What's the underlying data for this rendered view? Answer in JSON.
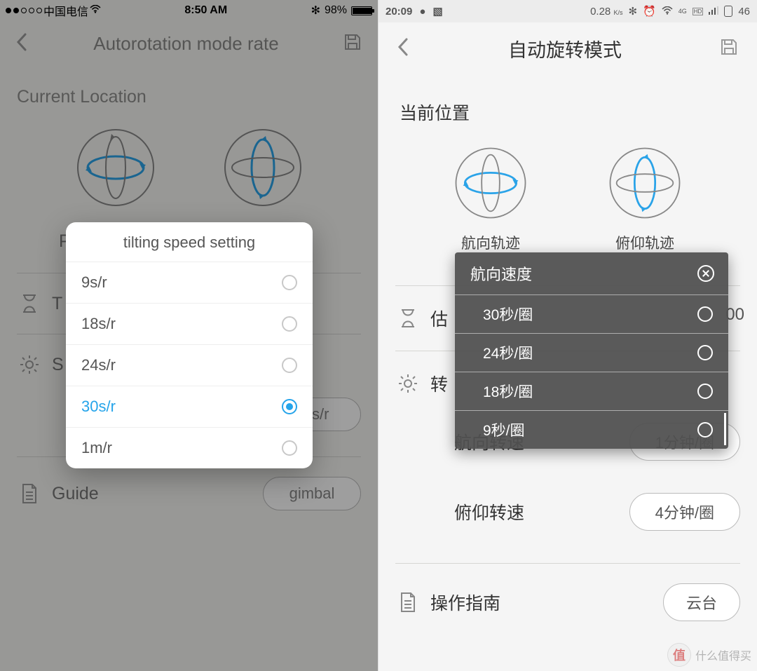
{
  "left": {
    "status": {
      "carrier": "中国电信",
      "time": "8:50 AM",
      "bt": "✻",
      "battery_pct": "98%"
    },
    "navbar": {
      "title": "Autorotation mode rate"
    },
    "section_location": "Current Location",
    "orbit_labels": {
      "pan": "",
      "tilt": ""
    },
    "rows": {
      "tilt_speed_label": "Tilting speed",
      "tilt_speed_value": "30s/r",
      "guide_label": "Guide",
      "guide_value": "gimbal",
      "hidden_row1_prefix": "T",
      "hidden_row2_prefix": "S",
      "hidden_row3_prefix": "P"
    },
    "popup": {
      "title": "tilting speed setting",
      "options": [
        "9s/r",
        "18s/r",
        "24s/r",
        "30s/r",
        "1m/r"
      ],
      "selected_index": 3
    }
  },
  "right": {
    "status": {
      "time": "20:09",
      "net_rate": "0.28",
      "net_unit": "K/s",
      "hd": "HD",
      "net_gen": "4G",
      "battery": "46"
    },
    "navbar": {
      "title": "自动旋转模式"
    },
    "section_location": "当前位置",
    "orbit_labels": {
      "pan": "航向轨迹",
      "tilt": "俯仰轨迹"
    },
    "partial_rows": {
      "estimate_prefix": "估",
      "estimate_tail": "00",
      "turn_prefix": "转"
    },
    "rows": {
      "pan_speed_label": "航向转速",
      "pan_speed_value": "1分钟/圈",
      "tilt_speed_label": "俯仰转速",
      "tilt_speed_value": "4分钟/圈",
      "guide_label": "操作指南",
      "guide_value": "云台"
    },
    "panel": {
      "title": "航向速度",
      "options": [
        "30秒/圈",
        "24秒/圈",
        "18秒/圈",
        "9秒/圈"
      ]
    },
    "watermark": {
      "glyph": "值",
      "text": "什么值得买"
    }
  }
}
